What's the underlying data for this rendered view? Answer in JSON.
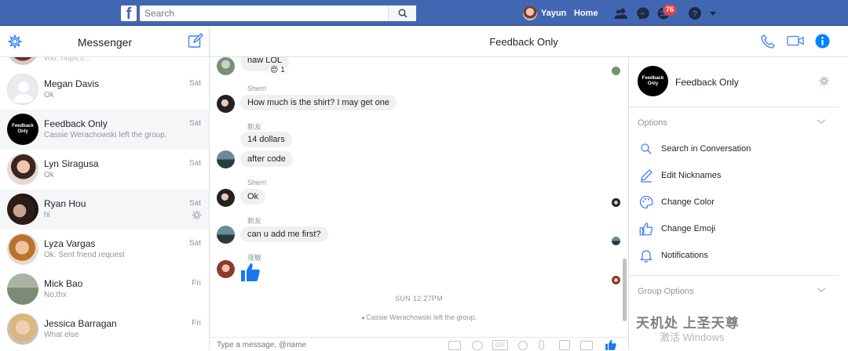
{
  "topbar": {
    "search_placeholder": "Search",
    "profile_name": "Yayun",
    "home_label": "Home",
    "notifications_count": "76",
    "brand_color": "#4267b2"
  },
  "left": {
    "title": "Messenger",
    "conversations": [
      {
        "name": "",
        "snippet": "",
        "time": ""
      },
      {
        "name": "Megan Davis",
        "snippet": "Ok",
        "time": "Sat"
      },
      {
        "name": "Feedback Only",
        "snippet": "Cassie Werachowski left the group.",
        "time": "Sat"
      },
      {
        "name": "Lyn Siragusa",
        "snippet": "Ok",
        "time": "Sat"
      },
      {
        "name": "Ryan Hou",
        "snippet": "hi",
        "time": "Sat"
      },
      {
        "name": "Lyza Vargas",
        "snippet": "Ok. Sent friend request",
        "time": "Sat"
      },
      {
        "name": "Mick Bao",
        "snippet": "No,thx",
        "time": "Fri"
      },
      {
        "name": "Jessica Barragan",
        "snippet": "What else",
        "time": "Fri"
      }
    ]
  },
  "chat": {
    "title": "Feedback Only",
    "messages": [
      {
        "text": "naw LOL",
        "reaction": "😍 1"
      },
      {
        "sender": "Sherri",
        "text": "How much is the shirt? I may get one"
      },
      {
        "sender": "新友",
        "text": "14 dollars"
      },
      {
        "text": "after code"
      },
      {
        "sender": "Sherri",
        "text": "Ok"
      },
      {
        "sender": "新友",
        "text": "can u add me first?"
      },
      {
        "sender": "涨敏"
      }
    ],
    "timestamp": "SUN 12:27PM",
    "system_message": "Cassie Werachowski left the group.",
    "composer_placeholder": "Type a message, @name"
  },
  "details": {
    "group_name": "Feedback Only",
    "group_avatar_text": "Feedback Only",
    "options_title": "Options",
    "options": [
      {
        "label": "Search in Conversation",
        "icon": "search-icon"
      },
      {
        "label": "Edit Nicknames",
        "icon": "pencil-icon"
      },
      {
        "label": "Change Color",
        "icon": "palette-icon"
      },
      {
        "label": "Change Emoji",
        "icon": "thumbs-up-icon"
      },
      {
        "label": "Notifications",
        "icon": "bell-icon"
      }
    ],
    "group_options_title": "Group Options"
  },
  "watermark": {
    "text": "天机处 上圣天尊",
    "activation": "激活 Windows"
  }
}
